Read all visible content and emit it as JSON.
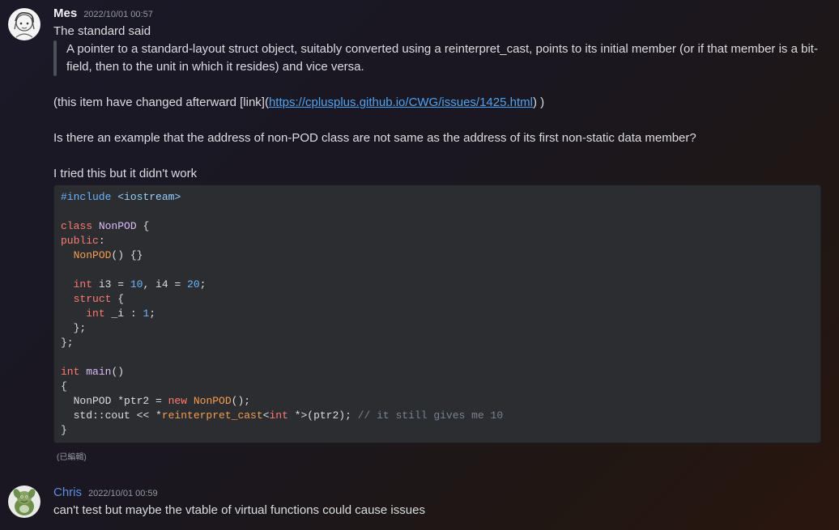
{
  "messages": [
    {
      "username": "Mes",
      "timestamp": "2022/10/01 00:57",
      "line1": "The standard said",
      "quote": "A pointer to a standard-layout struct object, suitably converted using a reinterpret_cast, points to its initial member (or if that member is a bit-field, then to the unit in which it resides) and vice versa.",
      "changed_prefix": "(this item have changed afterward [link](",
      "changed_link": "https://cplusplus.github.io/CWG/issues/1425.html",
      "changed_suffix": ") )",
      "question": "Is there an example that the address of non-POD class are not same as the address of its first non-static data member?",
      "tried": "I tried this but it didn't work",
      "edited": "(已編輯)",
      "code": {
        "l1_a": "#include",
        "l1_b": "<iostream>",
        "l3_kw": "class",
        "l3_name": "NonPOD",
        "l3_rest": " {",
        "l4_kw": "public",
        "l4_rest": ":",
        "l5_fn": "NonPOD",
        "l5_rest": "() {}",
        "l7_kw": "int",
        "l7_a": " i3 = ",
        "l7_n1": "10",
        "l7_b": ", i4 = ",
        "l7_n2": "20",
        "l7_c": ";",
        "l8_kw": "struct",
        "l8_rest": " {",
        "l9_kw": "int",
        "l9_a": " _i : ",
        "l9_n": "1",
        "l9_b": ";",
        "l10": "  };",
        "l11": "};",
        "l13_kw": "int",
        "l13_fn": "main",
        "l13_rest": "()",
        "l14": "{",
        "l15_a": "  NonPOD *ptr2 = ",
        "l15_kw": "new",
        "l15_fn": "NonPOD",
        "l15_b": "();",
        "l16_a": "  std::cout << *",
        "l16_fn": "reinterpret_cast",
        "l16_b": "<",
        "l16_kw": "int",
        "l16_c": " *>(ptr2); ",
        "l16_cm": "// it still gives me 10",
        "l17": "}"
      }
    },
    {
      "username": "Chris",
      "timestamp": "2022/10/01 00:59",
      "text": "can't test but maybe the vtable of virtual functions could cause issues"
    }
  ],
  "colors": {
    "link": "#4ea3f2",
    "chris_name": "#5b8ee6",
    "code_bg": "#2b2d31"
  },
  "icons": {
    "avatar_mes": "avatar-sketch-girl",
    "avatar_chris": "avatar-green-creature"
  }
}
